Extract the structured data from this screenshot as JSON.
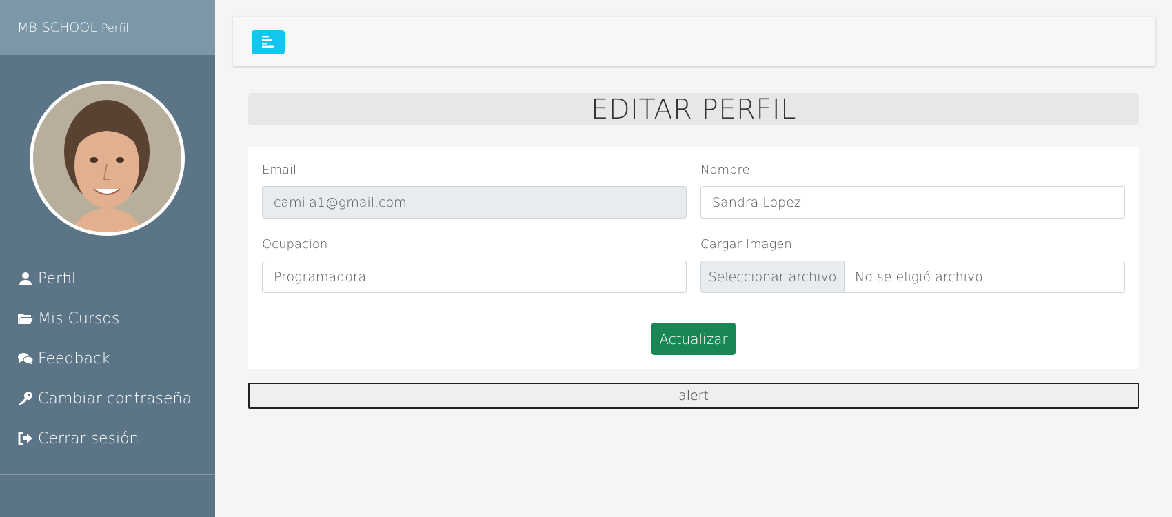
{
  "brand": {
    "name": "MB-SCHOOL",
    "sub": "Perfil"
  },
  "sidebar": {
    "avatar_alt": "profile photo",
    "items": [
      {
        "label": "Perfil",
        "icon": "user-icon"
      },
      {
        "label": "Mis Cursos",
        "icon": "folder-open-icon"
      },
      {
        "label": "Feedback",
        "icon": "comments-icon"
      },
      {
        "label": "Cambiar contraseña",
        "icon": "key-icon"
      },
      {
        "label": "Cerrar sesión",
        "icon": "sign-out-icon"
      }
    ]
  },
  "topbar": {
    "toggle_icon": "menu-align-left-icon"
  },
  "page": {
    "title": "EDITAR PERFIL"
  },
  "form": {
    "email_label": "Email",
    "email_value": "camila1@gmail.com",
    "nombre_label": "Nombre",
    "nombre_value": "Sandra Lopez",
    "ocupacion_label": "Ocupacion",
    "ocupacion_value": "Programadora",
    "imagen_label": "Cargar Imagen",
    "file_button": "Seleccionar archivo",
    "file_status": "No se eligió archivo",
    "submit_label": "Actualizar"
  },
  "alert": {
    "label": "alert"
  },
  "colors": {
    "sidebar": "#5b7586",
    "brand_bar": "#7b97a8",
    "toggle": "#13c6ef",
    "submit": "#198754"
  }
}
